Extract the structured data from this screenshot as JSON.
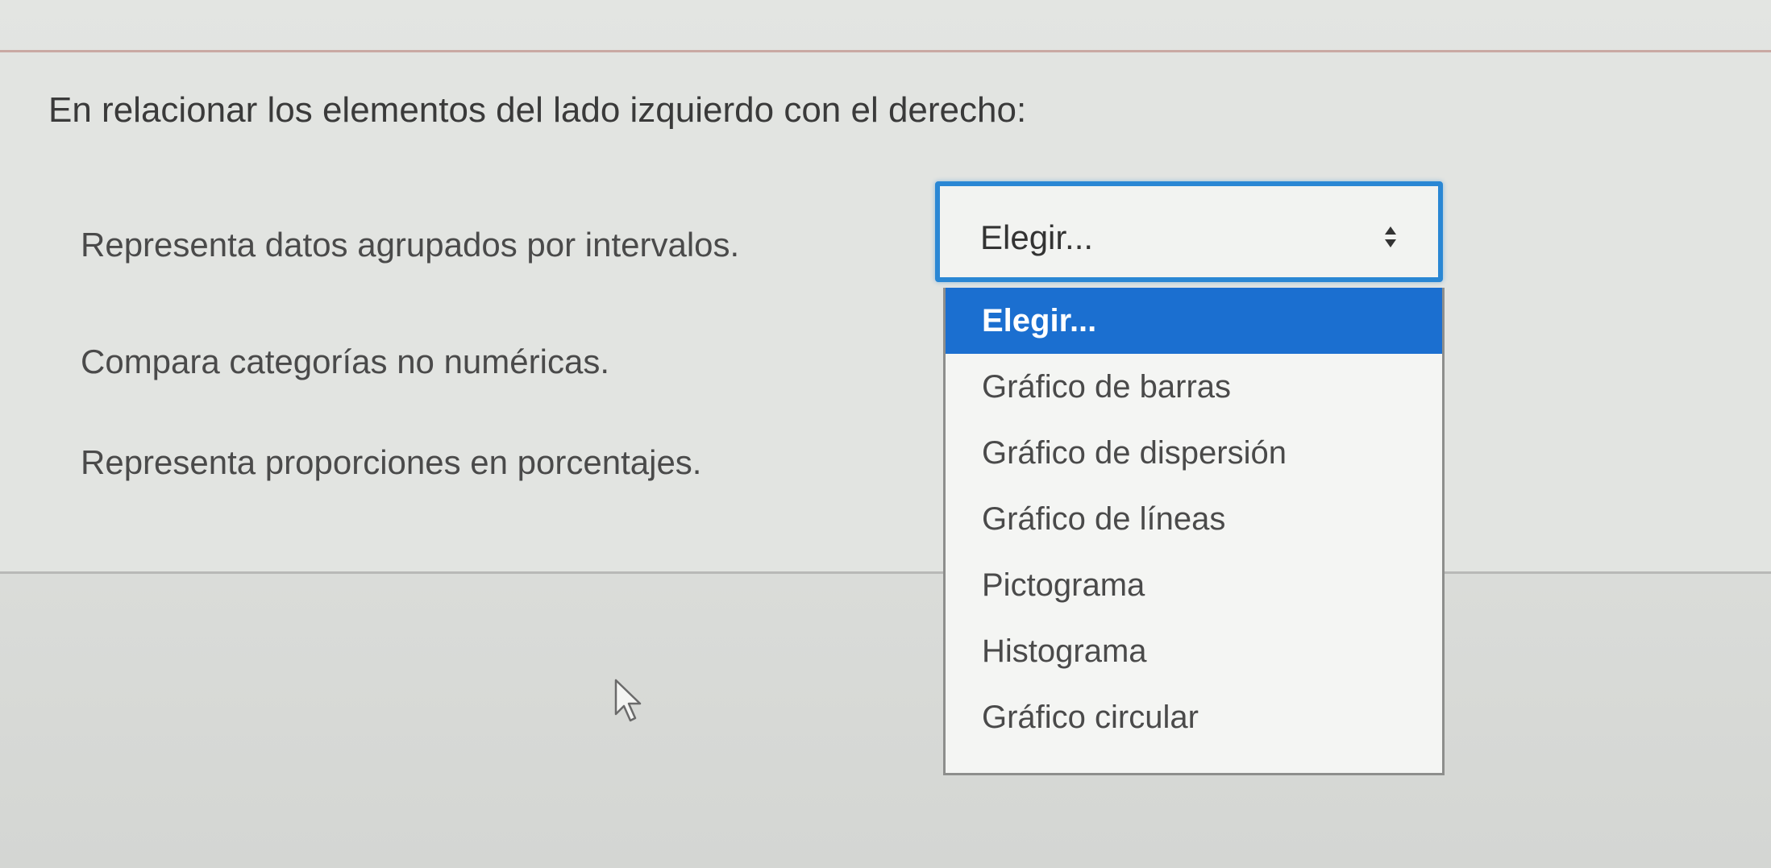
{
  "prompt": "En relacionar los elementos del lado izquierdo con el derecho:",
  "rows": [
    {
      "label": "Representa datos agrupados por intervalos."
    },
    {
      "label": "Compara categorías no numéricas."
    },
    {
      "label": "Representa proporciones en porcentajes."
    }
  ],
  "select": {
    "value": "Elegir...",
    "options": [
      "Elegir...",
      "Gráfico de barras",
      "Gráfico de dispersión",
      "Gráfico de líneas",
      "Pictograma",
      "Histograma",
      "Gráfico circular"
    ]
  },
  "icons": {
    "select_arrows": "up-down-arrows-icon",
    "cursor": "mouse-pointer-icon"
  },
  "colors": {
    "accent": "#2a87d4",
    "highlight": "#1b6fd0"
  }
}
